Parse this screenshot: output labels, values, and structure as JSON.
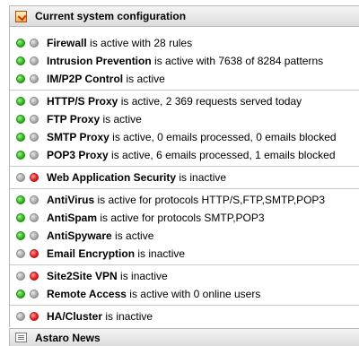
{
  "panel": {
    "title": "Current system configuration",
    "icon": "config-icon",
    "groups": [
      {
        "rows": [
          {
            "name": "Firewall",
            "status": "is active with 28 rules",
            "state": "active"
          },
          {
            "name": "Intrusion Prevention",
            "status": "is active with 7638 of 8284 patterns",
            "state": "active"
          },
          {
            "name": "IM/P2P Control",
            "status": "is active",
            "state": "active"
          }
        ]
      },
      {
        "rows": [
          {
            "name": "HTTP/S Proxy",
            "status": "is active, 2 369 requests served today",
            "state": "active"
          },
          {
            "name": "FTP Proxy",
            "status": "is active",
            "state": "active"
          },
          {
            "name": "SMTP Proxy",
            "status": "is active, 0 emails processed, 0 emails blocked",
            "state": "active"
          },
          {
            "name": "POP3 Proxy",
            "status": "is active, 6 emails processed, 1 emails blocked",
            "state": "active"
          }
        ]
      },
      {
        "rows": [
          {
            "name": "Web Application Security",
            "status": "is inactive",
            "state": "inactive"
          }
        ]
      },
      {
        "rows": [
          {
            "name": "AntiVirus",
            "status": "is active for protocols HTTP/S,FTP,SMTP,POP3",
            "state": "active"
          },
          {
            "name": "AntiSpam",
            "status": "is active for protocols SMTP,POP3",
            "state": "active"
          },
          {
            "name": "AntiSpyware",
            "status": "is active",
            "state": "active"
          },
          {
            "name": "Email Encryption",
            "status": "is inactive",
            "state": "inactive"
          }
        ]
      },
      {
        "rows": [
          {
            "name": "Site2Site VPN",
            "status": "is inactive",
            "state": "inactive"
          },
          {
            "name": "Remote Access",
            "status": "is active with 0 online users",
            "state": "active"
          }
        ]
      },
      {
        "rows": [
          {
            "name": "HA/Cluster",
            "status": "is inactive",
            "state": "inactive"
          }
        ]
      }
    ]
  },
  "news": {
    "title": "Astaro News",
    "icon": "news-icon"
  },
  "colors": {
    "active": "#2db51a",
    "inactive": "#e31b1b",
    "off": "#a8a8a8"
  }
}
